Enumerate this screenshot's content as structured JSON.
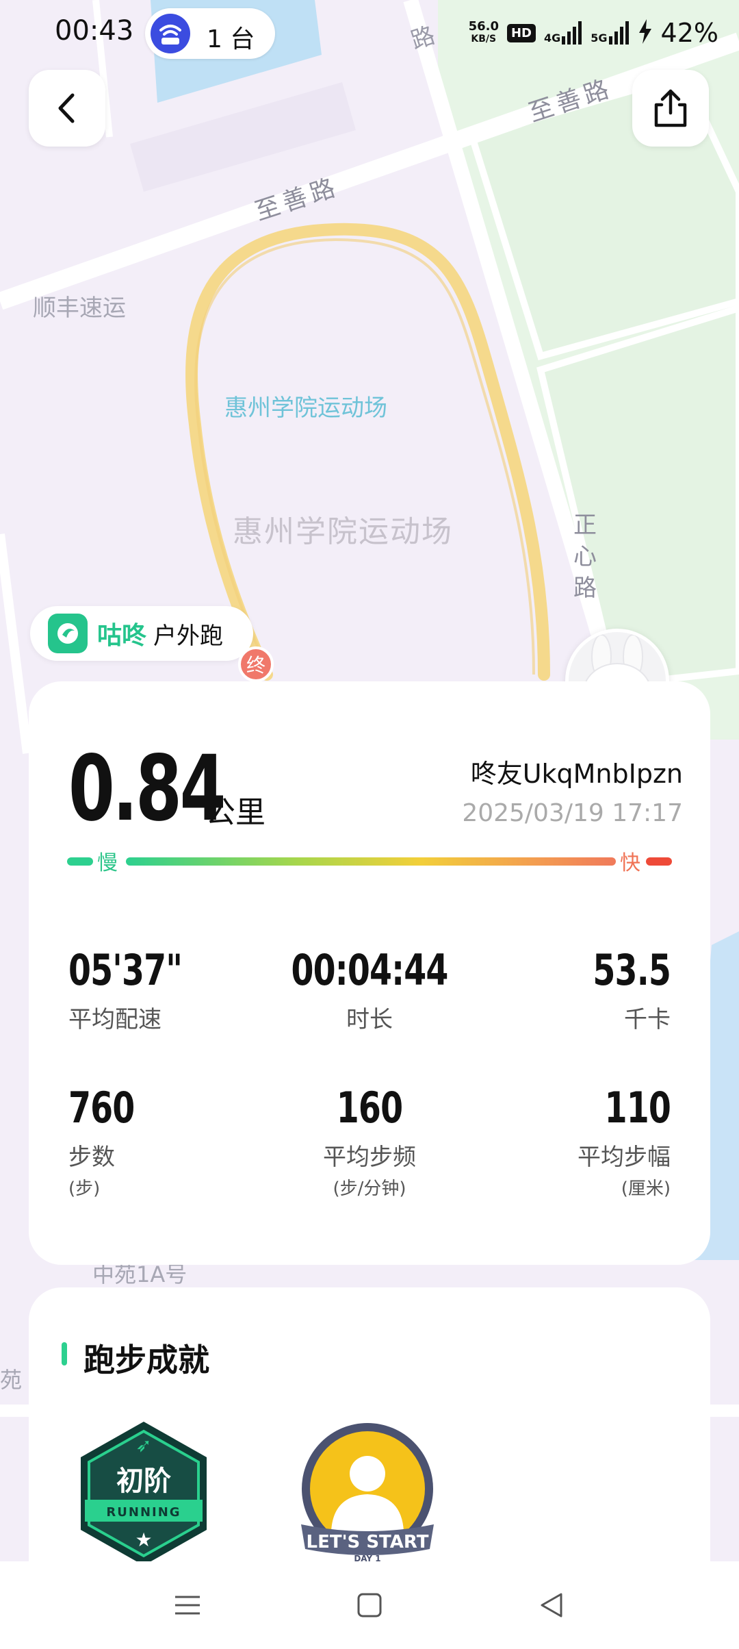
{
  "status_bar": {
    "time": "00:43",
    "device_count": "1 台",
    "net_speed_value": "56.0",
    "net_speed_unit": "KB/S",
    "hd_label": "HD",
    "signal_1": "4G",
    "signal_2": "5G",
    "battery": "42%"
  },
  "map": {
    "road_top_right": "至善路",
    "road_top_left": "至善路",
    "road_right_vertical": "正心路",
    "road_top_edge": "路",
    "poi_courier": "顺丰速运",
    "poi_stadium_label": "惠州学院运动场",
    "poi_stadium_area": "惠州学院运动场",
    "poi_bottom": "中苑1A号",
    "poi_left_edge": "苑",
    "end_marker": "终"
  },
  "app": {
    "brand": "咕咚",
    "sport_type": "户外跑"
  },
  "run": {
    "distance": "0.84",
    "distance_unit": "公里",
    "username": "咚友UkqMnbIpzn",
    "datetime": "2025/03/19 17:17",
    "pace_slow_label": "慢",
    "pace_fast_label": "快"
  },
  "metrics": {
    "avg_pace": {
      "value": "05'37\"",
      "label": "平均配速"
    },
    "duration": {
      "value": "00:04:44",
      "label": "时长"
    },
    "calories": {
      "value": "53.5",
      "label": "千卡"
    },
    "steps": {
      "value": "760",
      "label": "步数",
      "unit": "(步)"
    },
    "cadence": {
      "value": "160",
      "label": "平均步频",
      "unit": "(步/分钟)"
    },
    "stride": {
      "value": "110",
      "label": "平均步幅",
      "unit": "(厘米)"
    }
  },
  "achievements": {
    "title": "跑步成就",
    "badges": [
      {
        "top_text": "初阶",
        "ribbon_text": "RUNNING"
      },
      {
        "ribbon_text": "LET'S START",
        "sub_text": "DAY 1"
      }
    ]
  },
  "colors": {
    "brand_green": "#25c48c",
    "track": "#f5d98c",
    "pace_fast": "#ee4a38",
    "pace_slow": "#2dd08f"
  }
}
